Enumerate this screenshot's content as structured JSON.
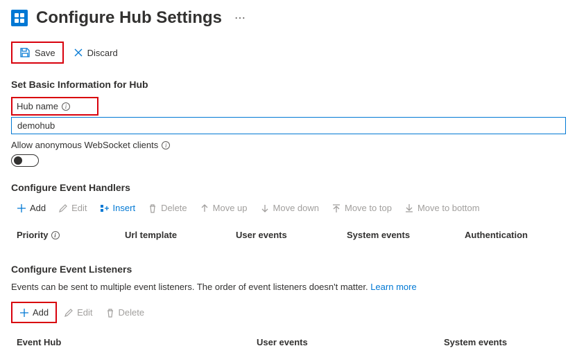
{
  "header": {
    "title": "Configure Hub Settings"
  },
  "actions": {
    "save": "Save",
    "discard": "Discard"
  },
  "basic": {
    "section_label": "Set Basic Information for Hub",
    "hub_name_label": "Hub name",
    "hub_name_value": "demohub",
    "allow_anon_label": "Allow anonymous WebSocket clients"
  },
  "handlers": {
    "section_label": "Configure Event Handlers",
    "tools": {
      "add": "Add",
      "edit": "Edit",
      "insert": "Insert",
      "delete": "Delete",
      "move_up": "Move up",
      "move_down": "Move down",
      "move_top": "Move to top",
      "move_bottom": "Move to bottom"
    },
    "cols": {
      "priority": "Priority",
      "url": "Url template",
      "user_events": "User events",
      "system_events": "System events",
      "auth": "Authentication"
    }
  },
  "listeners": {
    "section_label": "Configure Event Listeners",
    "hint": "Events can be sent to multiple event listeners. The order of event listeners doesn't matter.",
    "learn_more": "Learn more",
    "tools": {
      "add": "Add",
      "edit": "Edit",
      "delete": "Delete"
    },
    "cols": {
      "event_hub": "Event Hub",
      "user_events": "User events",
      "system_events": "System events"
    }
  }
}
